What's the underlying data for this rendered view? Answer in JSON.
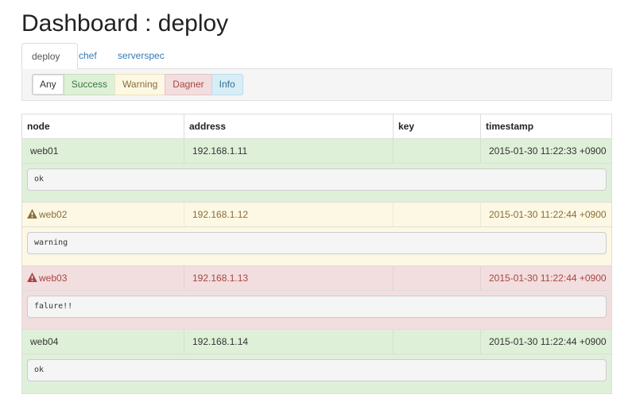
{
  "page_title": "Dashboard : deploy",
  "tabs": [
    {
      "label": "deploy",
      "active": true
    },
    {
      "label": "chef",
      "active": false
    },
    {
      "label": "serverspec",
      "active": false
    }
  ],
  "filters": {
    "any": "Any",
    "success": "Success",
    "warning": "Warning",
    "danger": "Dagner",
    "info": "Info"
  },
  "table": {
    "headers": {
      "node": "node",
      "address": "address",
      "key": "key",
      "timestamp": "timestamp"
    },
    "rows": [
      {
        "status": "success",
        "icon": "",
        "node": "web01",
        "address": "192.168.1.11",
        "key": "",
        "timestamp": "2015-01-30 11:22:33 +0900",
        "output": "ok"
      },
      {
        "status": "warning",
        "icon": "warning-icon",
        "node": "web02",
        "address": "192.168.1.12",
        "key": "",
        "timestamp": "2015-01-30 11:22:44 +0900",
        "output": "warning"
      },
      {
        "status": "danger",
        "icon": "warning-icon",
        "node": "web03",
        "address": "192.168.1.13",
        "key": "",
        "timestamp": "2015-01-30 11:22:44 +0900",
        "output": "falure!!"
      },
      {
        "status": "success",
        "icon": "",
        "node": "web04",
        "address": "192.168.1.14",
        "key": "",
        "timestamp": "2015-01-30 11:22:44 +0900",
        "output": "ok"
      }
    ]
  },
  "colors": {
    "success_bg": "#dff0d8",
    "warning_bg": "#fcf8e3",
    "danger_bg": "#f2dede",
    "info_bg": "#d9edf7",
    "link": "#337ab7"
  }
}
